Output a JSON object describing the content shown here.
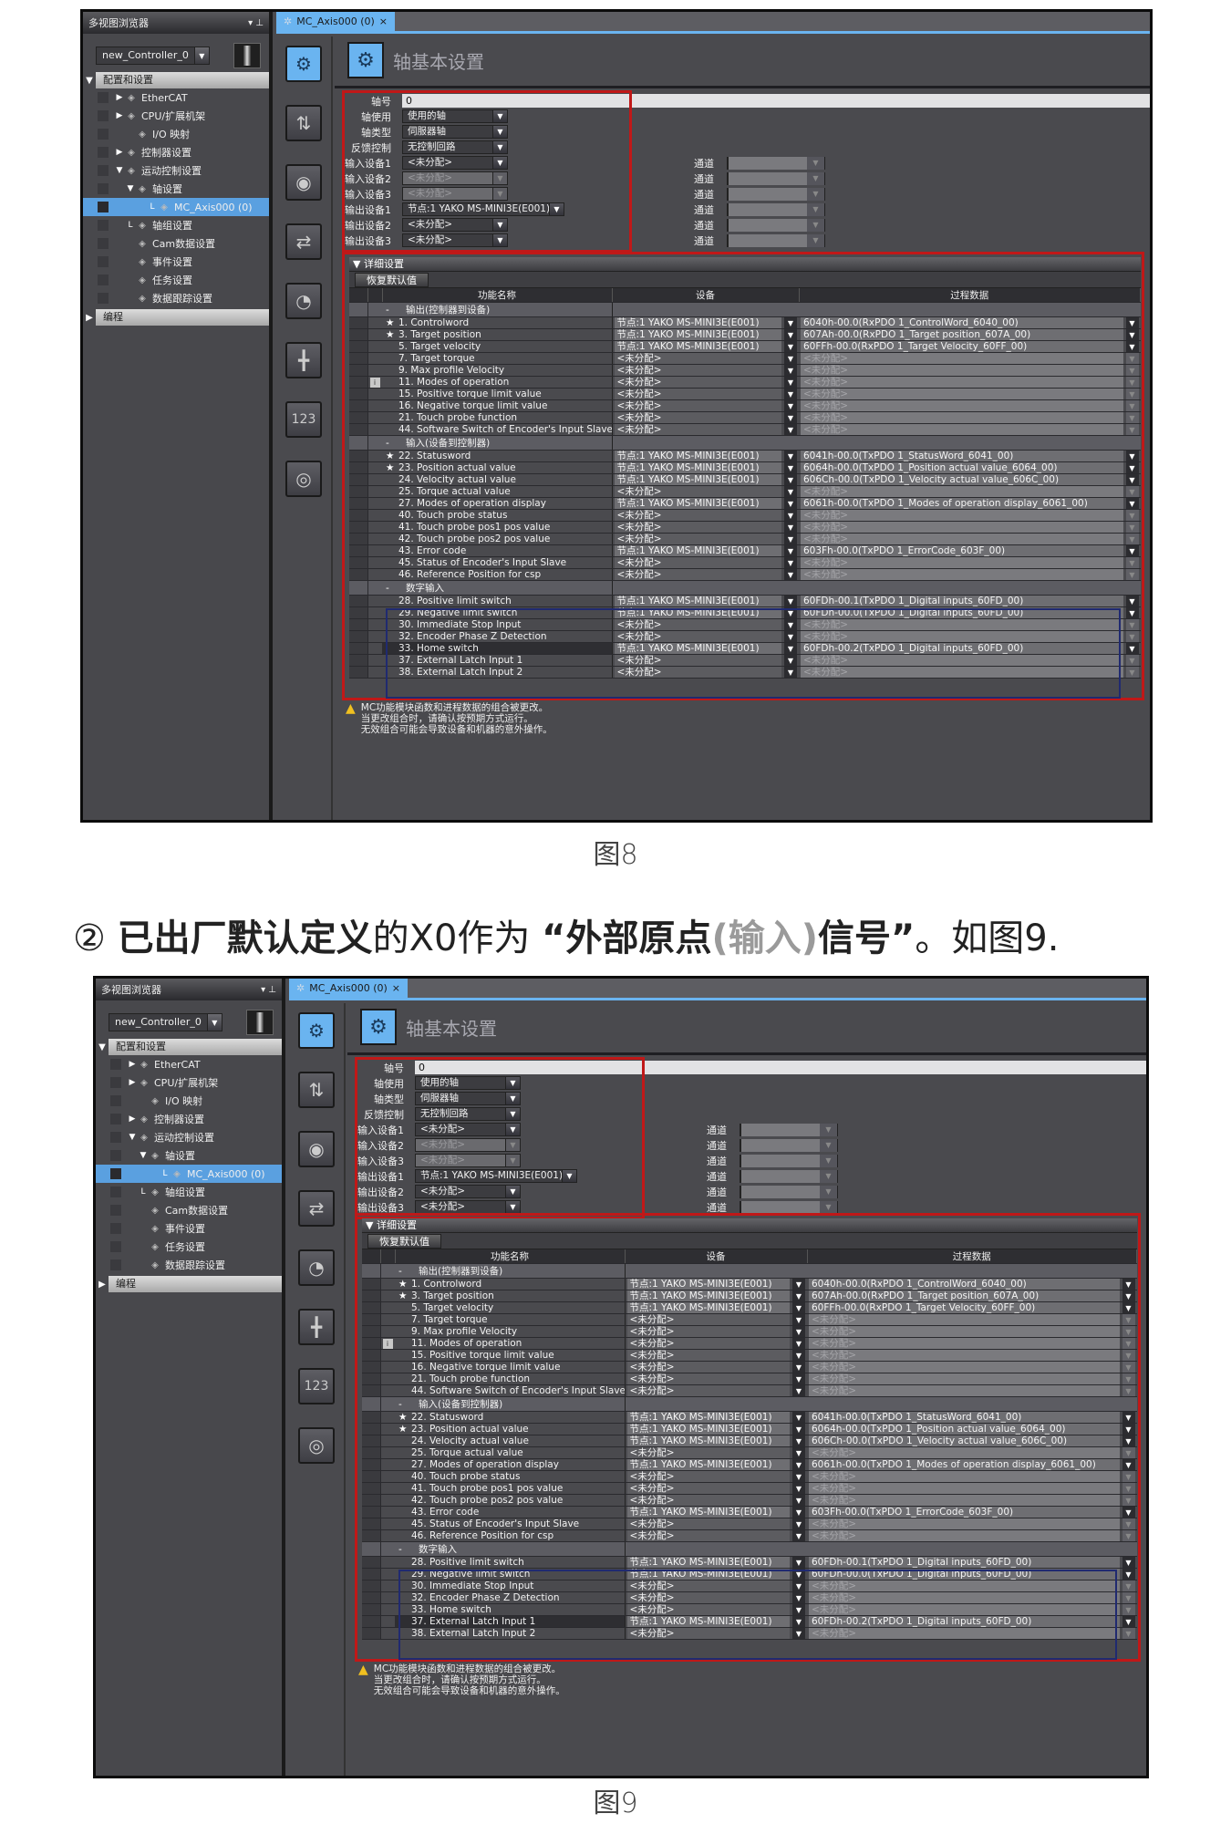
{
  "sidebar": {
    "title": "多视图浏览器",
    "controls": "▾ ⊥",
    "controller": "new_Controller_0",
    "root_config": "配置和设置",
    "items": [
      {
        "label": "EtherCAT",
        "indent": 0,
        "expander": "▶",
        "icon": "ethercat-icon"
      },
      {
        "label": "CPU/扩展机架",
        "indent": 0,
        "expander": "▶",
        "icon": "cpu-rack-icon"
      },
      {
        "label": "I/O 映射",
        "indent": 1,
        "expander": "",
        "icon": "io-map-icon"
      },
      {
        "label": "控制器设置",
        "indent": 0,
        "expander": "▶",
        "icon": "controller-settings-icon"
      },
      {
        "label": "运动控制设置",
        "indent": 0,
        "expander": "▼",
        "icon": "motion-gear-icon"
      },
      {
        "label": "轴设置",
        "indent": 1,
        "expander": "▼",
        "icon": "axis-gear-icon"
      },
      {
        "label": "MC_Axis000 (0)",
        "indent": 3,
        "expander": "",
        "icon": "axis-item-icon",
        "selected": true
      },
      {
        "label": "轴组设置",
        "indent": 1,
        "expander": "",
        "icon": "axis-group-icon"
      },
      {
        "label": "Cam数据设置",
        "indent": 1,
        "expander": "",
        "icon": "cam-icon"
      },
      {
        "label": "事件设置",
        "indent": 1,
        "expander": "",
        "icon": "flag-icon"
      },
      {
        "label": "任务设置",
        "indent": 1,
        "expander": "",
        "icon": "task-icon"
      },
      {
        "label": "数据跟踪设置",
        "indent": 1,
        "expander": "",
        "icon": "trace-icon"
      }
    ],
    "root_programming": "编程"
  },
  "tab": {
    "label": "MC_Axis000 (0)",
    "close": "×"
  },
  "heading": "轴基本设置",
  "basic": {
    "axis_number_label": "轴号",
    "axis_number_value": "0",
    "fields": [
      {
        "label": "轴使用",
        "value": "使用的轴",
        "disabled": false
      },
      {
        "label": "轴类型",
        "value": "伺服器轴",
        "disabled": false
      },
      {
        "label": "反馈控制",
        "value": "无控制回路",
        "disabled": false
      },
      {
        "label": "输入设备1",
        "value": "<未分配>",
        "disabled": false
      },
      {
        "label": "输入设备2",
        "value": "<未分配>",
        "disabled": true
      },
      {
        "label": "输入设备3",
        "value": "<未分配>",
        "disabled": true
      },
      {
        "label": "输出设备1",
        "value": "节点:1 YAKO MS-MINI3E(E001)",
        "disabled": false,
        "wide": true
      },
      {
        "label": "输出设备2",
        "value": "<未分配>",
        "disabled": false
      },
      {
        "label": "输出设备3",
        "value": "<未分配>",
        "disabled": false
      }
    ],
    "channel_label": "通道",
    "channel_count": 6
  },
  "detail": {
    "title": "▼ 详细设置",
    "restore_button": "恢复默认值",
    "columns": [
      "功能名称",
      "设备",
      "过程数据"
    ],
    "unassigned": "<未分配>"
  },
  "warning": [
    "MC功能模块函数和进程数据的组合被更改。",
    "当更改组合时，请确认按预期方式运行。",
    "无效组合可能会导致设备和机器的意外操作。"
  ],
  "figures": [
    {
      "caption": "图8",
      "rows": [
        {
          "group": "输出(控制器到设备)"
        },
        {
          "name": "1. Controlword",
          "star": true,
          "device": "节点:1 YAKO MS-MINI3E(E001)",
          "pdo": "6040h-00.0(RxPDO 1_ControlWord_6040_00)"
        },
        {
          "name": "3. Target position",
          "star": true,
          "device": "节点:1 YAKO MS-MINI3E(E001)",
          "pdo": "607Ah-00.0(RxPDO 1_Target position_607A_00)"
        },
        {
          "name": "5. Target velocity",
          "device": "节点:1 YAKO MS-MINI3E(E001)",
          "pdo": "60FFh-00.0(RxPDO 1_Target Velocity_60FF_00)"
        },
        {
          "name": "7. Target torque",
          "device": null,
          "pdo": null
        },
        {
          "name": "9. Max profile Velocity",
          "device": null,
          "pdo": null
        },
        {
          "name": "11. Modes of operation",
          "info": true,
          "device": null,
          "pdo": null
        },
        {
          "name": "15. Positive torque limit value",
          "device": null,
          "pdo": null
        },
        {
          "name": "16. Negative torque limit value",
          "device": null,
          "pdo": null
        },
        {
          "name": "21. Touch probe function",
          "device": null,
          "pdo": null
        },
        {
          "name": "44. Software Switch of Encoder's Input Slave",
          "device": null,
          "pdo": null
        },
        {
          "group": "输入(设备到控制器)"
        },
        {
          "name": "22. Statusword",
          "star": true,
          "device": "节点:1 YAKO MS-MINI3E(E001)",
          "pdo": "6041h-00.0(TxPDO 1_StatusWord_6041_00)"
        },
        {
          "name": "23. Position actual value",
          "star": true,
          "device": "节点:1 YAKO MS-MINI3E(E001)",
          "pdo": "6064h-00.0(TxPDO 1_Position actual value_6064_00)"
        },
        {
          "name": "24. Velocity actual value",
          "device": "节点:1 YAKO MS-MINI3E(E001)",
          "pdo": "606Ch-00.0(TxPDO 1_Velocity actual value_606C_00)"
        },
        {
          "name": "25. Torque actual value",
          "device": null,
          "pdo": null
        },
        {
          "name": "27. Modes of operation display",
          "device": "节点:1 YAKO MS-MINI3E(E001)",
          "pdo": "6061h-00.0(TxPDO 1_Modes of operation display_6061_00)"
        },
        {
          "name": "40. Touch probe status",
          "device": null,
          "pdo": null
        },
        {
          "name": "41. Touch probe pos1 pos value",
          "device": null,
          "pdo": null
        },
        {
          "name": "42. Touch probe pos2 pos value",
          "device": null,
          "pdo": null
        },
        {
          "name": "43. Error code",
          "device": "节点:1 YAKO MS-MINI3E(E001)",
          "pdo": "603Fh-00.0(TxPDO 1_ErrorCode_603F_00)"
        },
        {
          "name": "45. Status of Encoder's Input Slave",
          "device": null,
          "pdo": null
        },
        {
          "name": "46. Reference Position for csp",
          "device": null,
          "pdo": null
        },
        {
          "group": "数字输入"
        },
        {
          "name": "28. Positive limit switch",
          "device": "节点:1 YAKO MS-MINI3E(E001)",
          "pdo": "60FDh-00.1(TxPDO 1_Digital inputs_60FD_00)"
        },
        {
          "name": "29. Negative limit switch",
          "device": "节点:1 YAKO MS-MINI3E(E001)",
          "pdo": "60FDh-00.0(TxPDO 1_Digital inputs_60FD_00)"
        },
        {
          "name": "30. Immediate Stop Input",
          "device": null,
          "pdo": null
        },
        {
          "name": "32. Encoder Phase Z Detection",
          "device": null,
          "pdo": null
        },
        {
          "name": "33. Home switch",
          "highlight": true,
          "device": "节点:1 YAKO MS-MINI3E(E001)",
          "pdo": "60FDh-00.2(TxPDO 1_Digital inputs_60FD_00)"
        },
        {
          "name": "37. External Latch Input 1",
          "device": null,
          "pdo": null
        },
        {
          "name": "38. External Latch Input 2",
          "device": null,
          "pdo": null
        }
      ]
    },
    {
      "caption": "图9",
      "rows": [
        {
          "group": "输出(控制器到设备)"
        },
        {
          "name": "1. Controlword",
          "star": true,
          "device": "节点:1 YAKO MS-MINI3E(E001)",
          "pdo": "6040h-00.0(RxPDO 1_ControlWord_6040_00)"
        },
        {
          "name": "3. Target position",
          "star": true,
          "device": "节点:1 YAKO MS-MINI3E(E001)",
          "pdo": "607Ah-00.0(RxPDO 1_Target position_607A_00)"
        },
        {
          "name": "5. Target velocity",
          "device": "节点:1 YAKO MS-MINI3E(E001)",
          "pdo": "60FFh-00.0(RxPDO 1_Target Velocity_60FF_00)"
        },
        {
          "name": "7. Target torque",
          "device": null,
          "pdo": null
        },
        {
          "name": "9. Max profile Velocity",
          "device": null,
          "pdo": null
        },
        {
          "name": "11. Modes of operation",
          "info": true,
          "device": null,
          "pdo": null
        },
        {
          "name": "15. Positive torque limit value",
          "device": null,
          "pdo": null
        },
        {
          "name": "16. Negative torque limit value",
          "device": null,
          "pdo": null
        },
        {
          "name": "21. Touch probe function",
          "device": null,
          "pdo": null
        },
        {
          "name": "44. Software Switch of Encoder's Input Slave",
          "device": null,
          "pdo": null
        },
        {
          "group": "输入(设备到控制器)"
        },
        {
          "name": "22. Statusword",
          "star": true,
          "device": "节点:1 YAKO MS-MINI3E(E001)",
          "pdo": "6041h-00.0(TxPDO 1_StatusWord_6041_00)"
        },
        {
          "name": "23. Position actual value",
          "star": true,
          "device": "节点:1 YAKO MS-MINI3E(E001)",
          "pdo": "6064h-00.0(TxPDO 1_Position actual value_6064_00)"
        },
        {
          "name": "24. Velocity actual value",
          "device": "节点:1 YAKO MS-MINI3E(E001)",
          "pdo": "606Ch-00.0(TxPDO 1_Velocity actual value_606C_00)"
        },
        {
          "name": "25. Torque actual value",
          "device": null,
          "pdo": null
        },
        {
          "name": "27. Modes of operation display",
          "device": "节点:1 YAKO MS-MINI3E(E001)",
          "pdo": "6061h-00.0(TxPDO 1_Modes of operation display_6061_00)"
        },
        {
          "name": "40. Touch probe status",
          "device": null,
          "pdo": null
        },
        {
          "name": "41. Touch probe pos1 pos value",
          "device": null,
          "pdo": null
        },
        {
          "name": "42. Touch probe pos2 pos value",
          "device": null,
          "pdo": null
        },
        {
          "name": "43. Error code",
          "device": "节点:1 YAKO MS-MINI3E(E001)",
          "pdo": "603Fh-00.0(TxPDO 1_ErrorCode_603F_00)"
        },
        {
          "name": "45. Status of Encoder's Input Slave",
          "device": null,
          "pdo": null
        },
        {
          "name": "46. Reference Position for csp",
          "device": null,
          "pdo": null
        },
        {
          "group": "数字输入"
        },
        {
          "name": "28. Positive limit switch",
          "device": "节点:1 YAKO MS-MINI3E(E001)",
          "pdo": "60FDh-00.1(TxPDO 1_Digital inputs_60FD_00)"
        },
        {
          "name": "29. Negative limit switch",
          "device": "节点:1 YAKO MS-MINI3E(E001)",
          "pdo": "60FDh-00.0(TxPDO 1_Digital inputs_60FD_00)"
        },
        {
          "name": "30. Immediate Stop Input",
          "device": null,
          "pdo": null
        },
        {
          "name": "32. Encoder Phase Z Detection",
          "device": null,
          "pdo": null
        },
        {
          "name": "33. Home switch",
          "device": null,
          "pdo": null
        },
        {
          "name": "37. External Latch Input 1",
          "highlight": true,
          "device": "节点:1 YAKO MS-MINI3E(E001)",
          "pdo": "60FDh-00.2(TxPDO 1_Digital inputs_60FD_00)"
        },
        {
          "name": "38. External Latch Input 2",
          "device": null,
          "pdo": null
        }
      ]
    }
  ],
  "subtitle": {
    "num": "②",
    "bold1": "已出厂默认定义",
    "normal1": "的X0作为",
    "bold2": "“外部原点",
    "gray": "(输入)",
    "bold3": "信号”",
    "normal2": "。如图9."
  },
  "colors": {
    "accent": "#6ab4f0",
    "highlight_box": "#c01818",
    "digital_box": "#202a70",
    "warning": "#f0c020"
  }
}
